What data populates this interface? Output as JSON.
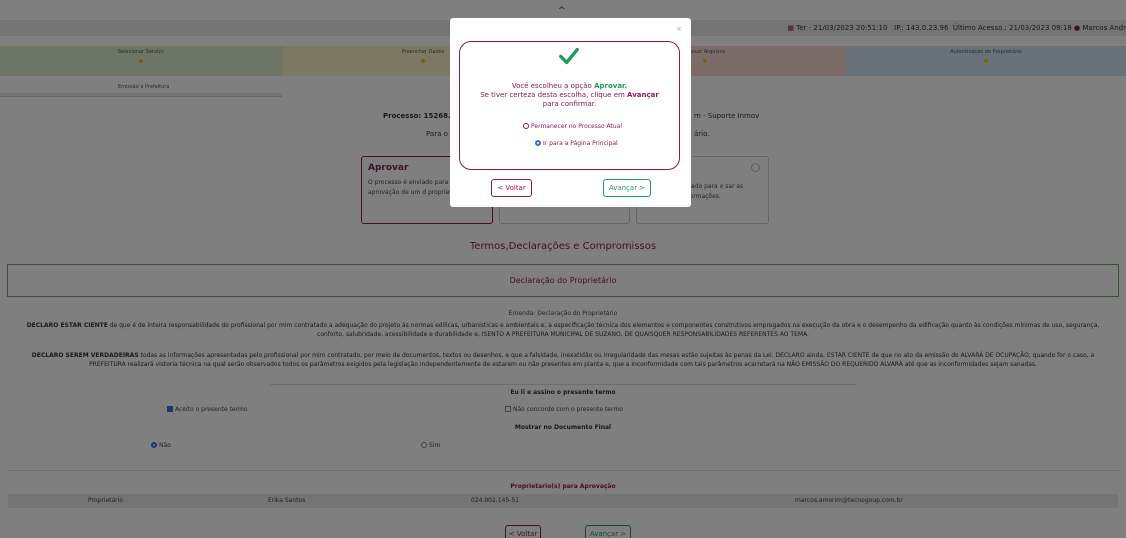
{
  "colors": {
    "brand": "#8b1a55",
    "success": "#1e9a5b",
    "accent": "#3b6fd6"
  },
  "header": {
    "datetime": "Ter - 21/03/2023 20:51:10",
    "ip": "IP.: 143.0.23.96",
    "last_access": "Último Acesso.: 21/03/2023 09:18",
    "user": "Marcos Andr",
    "calendar_icon": "calendar-icon",
    "user_icon": "user-icon"
  },
  "steps": [
    {
      "label": "Selecionar Serviço",
      "color": "#dbeacb"
    },
    {
      "label": "Preencher Dados",
      "color": "#f7f2c9"
    },
    {
      "label": "Anexar Arquivos",
      "color": "#f6d8d4"
    },
    {
      "label": "Autenticação do Proprietário",
      "color": "#d3e3f3"
    }
  ],
  "substep": {
    "label": "Emissão a Prefeitura"
  },
  "process": {
    "number": "Processo: 15268.2023",
    "suporte": "m - Suporte Inmov",
    "para_o": "Para o Pr",
    "ario": "ário."
  },
  "cards": [
    {
      "title": "Aprovar",
      "desc": "O processo é enviado para após a aprovação de um d proprietários."
    },
    {
      "desc": "nviado para o sar as informações."
    }
  ],
  "terms": {
    "title": "Termos,Declarações e Compromissos",
    "box_title": "Declaração do Proprietário",
    "emenda": "Emenda: Declaração do Proprietário",
    "p1_lead": "DECLARO ESTAR CIENTE",
    "p1_rest": " de que é de inteira responsabilidade do profissional por mim contratado a adequação do projeto às normas edílicas, urbanísticas e ambientais e, a especificação técnica dos elementos e componentes construtivos empregados na execução da obra e o desempenho da edificação quanto às condições mínimas de uso, segurança, conforto, salubridade, acessibilidade e durabilidade e, ISENTO A PREFEITURA MUNICIPAL DE SUZANO, DE QUAISQUER RESPONSABILIDADES REFERENTES AO TEMA.",
    "p2_lead": "DECLARO SEREM VERDADEIRAS",
    "p2_rest": " todas as informações apresentadas pelo profissional por mim contratado, por meio de documentos, textos ou desenhos, e que a falsidade, inexatidão ou irregularidade das mesas estão sujeitas às penas da Lei. DECLARO ainda, ESTAR CIENTE de que no ato da emissão do ALVARÁ DE OCUPAÇÃO, quando for o caso, a PREFEITURA realizará vistoria técnica na qual serão observados todos os parâmetros exigidos pela legislação independentemente de estarem ou não presentes em planta e, que a inconformidade com tais parâmetros acarretará na NÃO EMISSÃO DO REQUERIDO ALVARÁ até que as inconformidades sejam sanadas.",
    "eu_li": "Eu li e assino o presente termo",
    "accept": "Aceito o presente termo",
    "decline": "Não concordo com o presente termo",
    "mostrar": "Mostrar no Documento Final",
    "nao": "Não",
    "sim": "Sim"
  },
  "owners": {
    "title": "Proprietario(s) para Aprovação",
    "row": {
      "role": "Proprietário",
      "name": "Erika Santos",
      "cpf": "024.902.145-51",
      "email": "marcos.amorim@tecnogoup.com.br"
    }
  },
  "buttons": {
    "back": "< Voltar",
    "next": "Avançar >"
  },
  "modal": {
    "close": "×",
    "line1_pre": "Você escolheu a opção ",
    "line1_choice": "Aprovar.",
    "line2_pre": "Se tiver certeza desta escolha, clique em ",
    "line2_choice": "Avançar",
    "line3": "para confirmar.",
    "opt1": "Permanecer no Processo Atual",
    "opt2": "Ir para a Página Principal",
    "back": "< Voltar",
    "next": "Avançar >"
  }
}
